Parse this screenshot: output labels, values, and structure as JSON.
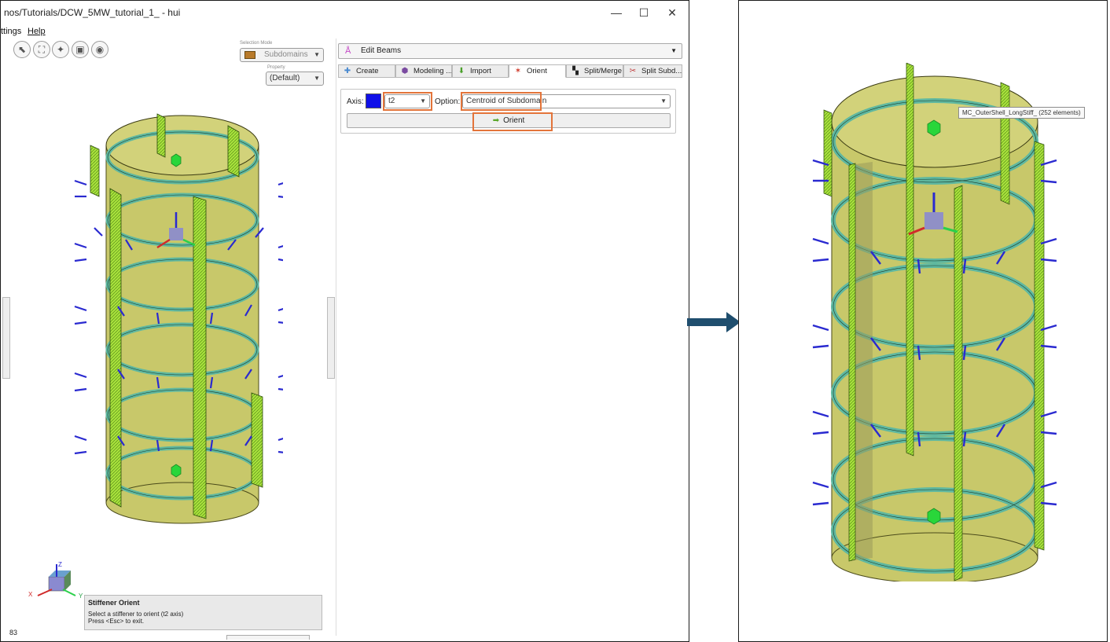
{
  "window": {
    "title": "nos/Tutorials/DCW_5MW_tutorial_1_ - hui",
    "minimize_glyph": "—",
    "maximize_glyph": "☐",
    "close_glyph": "✕"
  },
  "menu": {
    "items": [
      "ttings",
      "Help"
    ]
  },
  "viewport_toolbar": {
    "selection_mode_label": "Selection Mode",
    "selection_mode_value": "Subdomains",
    "property_label": "Property",
    "property_value": "(Default)"
  },
  "help_box": {
    "title": "Stiffener Orient",
    "line1": "Select a stiffener to orient (t2 axis)",
    "line2": "Press <Esc> to exit."
  },
  "status": {
    "counter": "83"
  },
  "axis_triad": {
    "x": "X",
    "y": "Y",
    "z": "Z"
  },
  "panel": {
    "mode_value": "Edit Beams",
    "tabs": [
      {
        "label": "Create",
        "icon": "plus-icon",
        "active": false
      },
      {
        "label": "Modeling ...",
        "icon": "modeling-icon",
        "active": false
      },
      {
        "label": "Import",
        "icon": "import-arrow-icon",
        "active": false
      },
      {
        "label": "Orient",
        "icon": "triad-icon",
        "active": true
      },
      {
        "label": "Split/Merge",
        "icon": "split-merge-icon",
        "active": false
      },
      {
        "label": "Split Subd...",
        "icon": "scissors-icon",
        "active": false
      }
    ],
    "orient": {
      "axis_label": "Axis:",
      "axis_color": "#1010e8",
      "axis_value": "t2",
      "option_label": "Option:",
      "option_value": "Centroid of Subdomain",
      "button_label": "Orient"
    },
    "highlight_color": "#e3743a"
  },
  "right_view": {
    "tooltip": "MC_OuterShell_LongStiff_ (252 elements)"
  },
  "colors": {
    "shell": "#c8c86a",
    "stiffener": "#a8e23c",
    "ring": "#5fb8a0",
    "normal": "#2a2ad0",
    "point": "#29d63a"
  }
}
